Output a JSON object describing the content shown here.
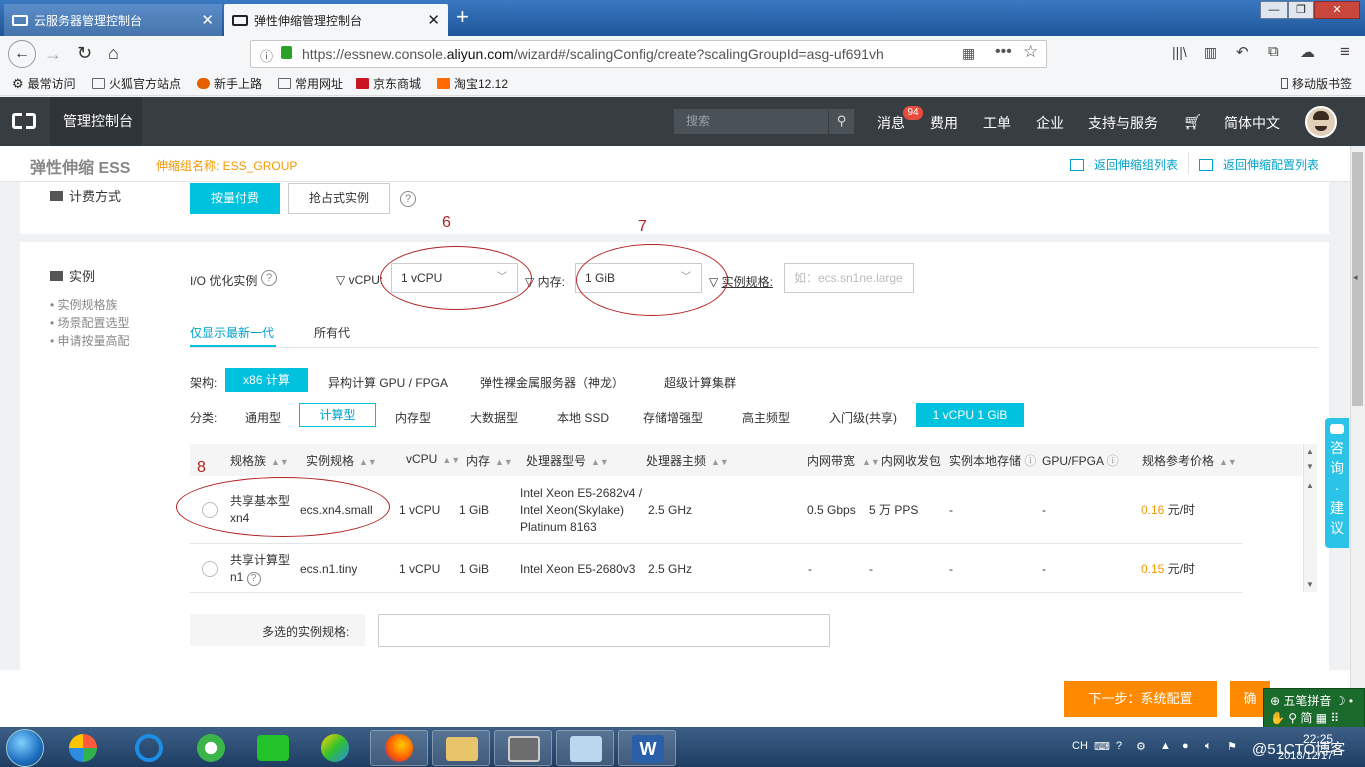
{
  "browser": {
    "tabs": [
      {
        "label": "云服务器管理控制台"
      },
      {
        "label": "弹性伸缩管理控制台"
      }
    ],
    "url_prefix": "https://essnew.console.",
    "url_domain": "aliyun.com",
    "url_suffix": "/wizard#/scalingConfig/create?scalingGroupId=asg-uf691vh",
    "bookmarks": [
      {
        "label": "最常访问"
      },
      {
        "label": "火狐官方站点"
      },
      {
        "label": "新手上路"
      },
      {
        "label": "常用网址"
      },
      {
        "label": "京东商城"
      },
      {
        "label": "淘宝12.12"
      }
    ],
    "mobile_bookmarks": "移动版书签"
  },
  "console": {
    "title": "管理控制台",
    "search_placeholder": "搜索",
    "nav": {
      "messages": "消息",
      "messages_count": "94",
      "billing": "费用",
      "tickets": "工单",
      "enterprise": "企业",
      "support": "支持与服务",
      "language": "简体中文"
    }
  },
  "subheader": {
    "title": "弹性伸缩 ESS",
    "group_label": "伸缩组名称: ESS_GROUP",
    "back_groups": "返回伸缩组列表",
    "back_configs": "返回伸缩配置列表"
  },
  "billing": {
    "label": "计费方式",
    "pay_as_you_go": "按量付费",
    "spot": "抢占式实例",
    "help": "?"
  },
  "instance": {
    "label": "实例",
    "side_links": [
      "实例规格族",
      "场景配置选型",
      "申请按量高配"
    ],
    "io_optimized": "I/O 优化实例",
    "help": "?",
    "vcpu_label": "vCPU:",
    "vcpu_value": "1 vCPU",
    "mem_label": "内存:",
    "mem_value": "1 GiB",
    "spec_label": "实例规格:",
    "spec_placeholder": "如：ecs.sn1ne.large",
    "gen_tabs": [
      "仅显示最新一代",
      "所有代"
    ],
    "arch_label": "架构:",
    "arch_options": [
      "x86 计算",
      "异构计算 GPU / FPGA",
      "弹性裸金属服务器（神龙）",
      "超级计算集群"
    ],
    "cat_label": "分类:",
    "cat_options": [
      "通用型",
      "计算型",
      "内存型",
      "大数据型",
      "本地 SSD",
      "存储增强型",
      "高主频型",
      "入门级(共享)"
    ],
    "filter_chip": "1 vCPU 1 GiB",
    "multi_label": "多选的实例规格:"
  },
  "table": {
    "headers": [
      "规格族",
      "实例规格",
      "vCPU",
      "内存",
      "处理器型号",
      "处理器主频",
      "内网带宽",
      "内网收发包",
      "实例本地存储",
      "GPU/FPGA",
      "规格参考价格"
    ],
    "rows": [
      {
        "family1": "共享基本型",
        "family2": "xn4",
        "spec": "ecs.xn4.small",
        "vcpu": "1 vCPU",
        "mem": "1 GiB",
        "cpu1": "Intel Xeon E5-2682v4 /",
        "cpu2": "Intel Xeon(Skylake)",
        "cpu3": "Platinum 8163",
        "freq": "2.5 GHz",
        "bw": "0.5 Gbps",
        "pps": "5 万 PPS",
        "storage": "-",
        "gpu": "-",
        "price": "0.16",
        "unit": "元/时"
      },
      {
        "family1": "共享计算型",
        "family2": "n1",
        "spec": "ecs.n1.tiny",
        "vcpu": "1 vCPU",
        "mem": "1 GiB",
        "cpu1": "Intel Xeon E5-2680v3",
        "freq": "2.5 GHz",
        "bw": "-",
        "pps": "-",
        "storage": "-",
        "gpu": "-",
        "price": "0.15",
        "unit": "元/时"
      }
    ]
  },
  "annotations": [
    "6",
    "7",
    "8"
  ],
  "feedback": "咨询·建议",
  "footer": {
    "next": "下一步：系统配置",
    "next2": "确"
  },
  "ime": {
    "line1": "五笔拼音",
    "line2": "简"
  },
  "taskbar": {
    "tray_lang": "CH",
    "time": "22:25",
    "date": "2018/12/17",
    "watermark": "@51CTO博客"
  }
}
